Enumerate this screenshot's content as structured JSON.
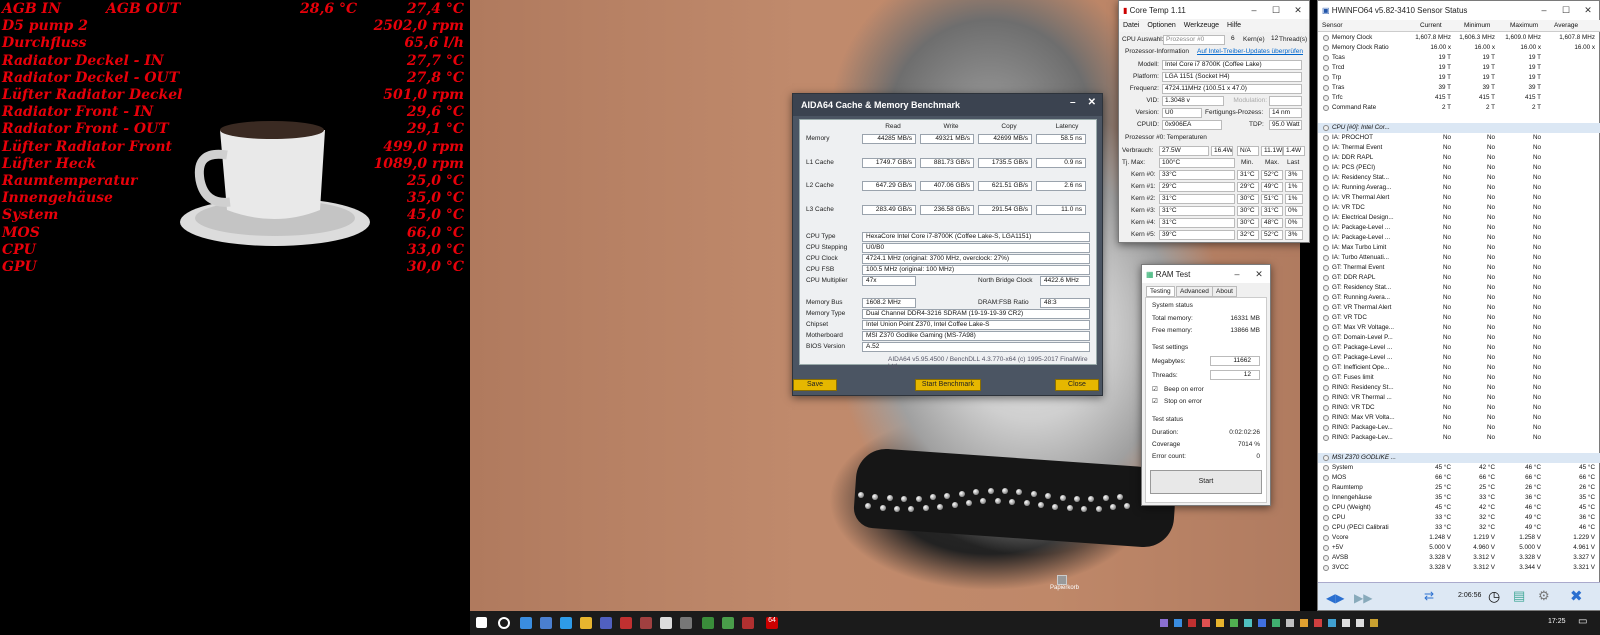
{
  "overlay": {
    "rows": [
      {
        "k": "AGB IN",
        "k2": "AGB OUT",
        "v2": "28,6 °C",
        "v": "27,4 °C"
      },
      {
        "k": "D5 pump 2",
        "v": "2502,0 rpm"
      },
      {
        "k": "Durchfluss",
        "v": "65,6 l/h"
      },
      {
        "k": "Radiator Deckel - IN",
        "v": "27,7 °C"
      },
      {
        "k": "Radiator Deckel - OUT",
        "v": "27,8 °C"
      },
      {
        "k": "Lüfter Radiator Deckel",
        "v": "501,0 rpm"
      },
      {
        "k": "Radiator Front - IN",
        "v": "29,6 °C"
      },
      {
        "k": "Radiator Front - OUT",
        "v": "29,1 °C"
      },
      {
        "k": "Lüfter Radiator Front",
        "v": "499,0 rpm"
      },
      {
        "k": "Lüfter Heck",
        "v": "1089,0 rpm"
      },
      {
        "k": "Raumtemperatur",
        "v": "25,0 °C"
      },
      {
        "k": "Innengehäuse",
        "v": "35,0 °C"
      },
      {
        "k": "System",
        "v": "45,0 °C"
      },
      {
        "k": "MOS",
        "v": "66,0 °C"
      },
      {
        "k": "CPU",
        "v": "33,0 °C"
      },
      {
        "k": "GPU",
        "v": "30,0 °C"
      }
    ]
  },
  "aida": {
    "title": "AIDA64 Cache & Memory Benchmark",
    "cols": [
      "Read",
      "Write",
      "Copy",
      "Latency"
    ],
    "rows": [
      {
        "label": "Memory",
        "v": [
          "44285 MB/s",
          "49321 MB/s",
          "42699 MB/s",
          "58.5 ns"
        ]
      },
      {
        "label": "L1 Cache",
        "v": [
          "1749.7 GB/s",
          "881.73 GB/s",
          "1735.5 GB/s",
          "0.9 ns"
        ]
      },
      {
        "label": "L2 Cache",
        "v": [
          "647.29 GB/s",
          "407.06 GB/s",
          "621.51 GB/s",
          "2.6 ns"
        ]
      },
      {
        "label": "L3 Cache",
        "v": [
          "283.49 GB/s",
          "236.58 GB/s",
          "291.54 GB/s",
          "11.0 ns"
        ]
      }
    ],
    "info": [
      {
        "label": "CPU Type",
        "v": "HexaCore Intel Core i7-8700K  (Coffee Lake-S, LGA1151)"
      },
      {
        "label": "CPU Stepping",
        "v": "U0/B0"
      },
      {
        "label": "CPU Clock",
        "v": "4724.1 MHz  (original: 3700 MHz, overclock: 27%)"
      },
      {
        "label": "CPU FSB",
        "v": "100.5 MHz  (original: 100 MHz)"
      },
      {
        "label": "CPU Multiplier",
        "v": "47x"
      }
    ],
    "nb_label": "North Bridge Clock",
    "nb_value": "4422.6 MHz",
    "info2": [
      {
        "label": "Memory Bus",
        "v": "1608.2 MHz"
      },
      {
        "label": "Memory Type",
        "v": "Dual Channel DDR4-3216 SDRAM  (19-19-19-39 CR2)"
      },
      {
        "label": "Chipset",
        "v": "Intel Union Point Z370, Intel Coffee Lake-S"
      },
      {
        "label": "Motherboard",
        "v": "MSI Z370 Godlike Gaming (MS-7A98)"
      },
      {
        "label": "BIOS Version",
        "v": "A.52"
      }
    ],
    "ratio_label": "DRAM:FSB Ratio",
    "ratio_value": "48:3",
    "footer": "AIDA64 v5.95.4500 / BenchDLL 4.3.770-x64  (c) 1995-2017 FinalWire Ltd.",
    "save": "Save",
    "start": "Start Benchmark",
    "close": "Close"
  },
  "coretemp": {
    "title": "Core Temp 1.11",
    "menu": [
      "Datei",
      "Optionen",
      "Werkzeuge",
      "Hilfe"
    ],
    "cpu_label": "CPU Auswahl:",
    "cpu_sel": "Prozessor #0",
    "cores": "6",
    "cores_label": "Kern(e)",
    "threads": "12",
    "threads_label": "Thread(s)",
    "proc_info": "Prozessor-Information",
    "link": "Auf Intel-Treiber-Updates überprüfen",
    "model_l": "Modell:",
    "model": "Intel Core i7 8700K (Coffee Lake)",
    "platform_l": "Platform:",
    "platform": "LGA 1151 (Socket H4)",
    "freq_l": "Frequenz:",
    "freq": "4724.11MHz (100.51 x 47.0)",
    "vid_l": "VID:",
    "vid": "1.3048 v",
    "mod_l": "Modulation:",
    "ver_l": "Version:",
    "ver": "U0",
    "fp_l": "Fertigungs-Prozess:",
    "fp": "14 nm",
    "cpuid_l": "CPUID:",
    "cpuid": "0x906EA",
    "tdp_l": "TDP:",
    "tdp": "95.0 Watt",
    "temps": "Prozessor #0: Temperaturen",
    "power_l": "Verbrauch:",
    "power": [
      "27.5W",
      "16.4W",
      "N/A",
      "11.1W",
      "1.4W"
    ],
    "tjmax_l": "Tj. Max:",
    "tjmax": "100°C",
    "min": "Min.",
    "max": "Max.",
    "last": "Last",
    "cores_t": [
      {
        "n": "Kern #0:",
        "t": "33°C",
        "mi": "31°C",
        "ma": "52°C",
        "l": "3%"
      },
      {
        "n": "Kern #1:",
        "t": "29°C",
        "mi": "29°C",
        "ma": "49°C",
        "l": "1%"
      },
      {
        "n": "Kern #2:",
        "t": "31°C",
        "mi": "30°C",
        "ma": "51°C",
        "l": "1%"
      },
      {
        "n": "Kern #3:",
        "t": "31°C",
        "mi": "30°C",
        "ma": "31°C",
        "l": "0%"
      },
      {
        "n": "Kern #4:",
        "t": "31°C",
        "mi": "30°C",
        "ma": "48°C",
        "l": "0%"
      },
      {
        "n": "Kern #5:",
        "t": "39°C",
        "mi": "32°C",
        "ma": "52°C",
        "l": "3%"
      }
    ]
  },
  "ramtest": {
    "title": "RAM Test",
    "tabs": [
      "Testing",
      "Advanced",
      "About"
    ],
    "sys_status": "System status",
    "total_l": "Total memory:",
    "total": "16331 MB",
    "free_l": "Free memory:",
    "free": "13866 MB",
    "settings": "Test settings",
    "mb_l": "Megabytes:",
    "mb": "11662",
    "th_l": "Threads:",
    "th": "12",
    "beep": "Beep on error",
    "stop": "Stop on error",
    "status": "Test status",
    "dur_l": "Duration:",
    "dur": "0:02:02:26",
    "cov_l": "Coverage",
    "cov": "7014 %",
    "err_l": "Error count:",
    "err": "0",
    "start": "Start"
  },
  "hwinfo": {
    "title": "HWiNFO64 v5.82-3410 Sensor Status",
    "cols": [
      "Sensor",
      "Current",
      "Minimum",
      "Maximum",
      "Average"
    ],
    "rows": [
      {
        "n": "Memory Clock",
        "c": "1,607.8 MHz",
        "mi": "1,606.3 MHz",
        "ma": "1,609.0 MHz",
        "a": "1,607.8 MHz"
      },
      {
        "n": "Memory Clock Ratio",
        "c": "16.00 x",
        "mi": "16.00 x",
        "ma": "16.00 x",
        "a": "16.00 x"
      },
      {
        "n": "Tcas",
        "c": "19 T",
        "mi": "19 T",
        "ma": "19 T",
        "a": ""
      },
      {
        "n": "Trcd",
        "c": "19 T",
        "mi": "19 T",
        "ma": "19 T",
        "a": ""
      },
      {
        "n": "Trp",
        "c": "19 T",
        "mi": "19 T",
        "ma": "19 T",
        "a": ""
      },
      {
        "n": "Tras",
        "c": "39 T",
        "mi": "39 T",
        "ma": "39 T",
        "a": ""
      },
      {
        "n": "Trfc",
        "c": "415 T",
        "mi": "415 T",
        "ma": "415 T",
        "a": ""
      },
      {
        "n": "Command Rate",
        "c": "2 T",
        "mi": "2 T",
        "ma": "2 T",
        "a": ""
      },
      {
        "n": "",
        "c": "",
        "mi": "",
        "ma": "",
        "a": ""
      },
      {
        "n": "CPU [#0]: Intel Cor...",
        "c": "",
        "mi": "",
        "ma": "",
        "a": "",
        "g": true
      },
      {
        "n": "IA: PROCHOT",
        "c": "No",
        "mi": "No",
        "ma": "No",
        "a": ""
      },
      {
        "n": "IA: Thermal Event",
        "c": "No",
        "mi": "No",
        "ma": "No",
        "a": ""
      },
      {
        "n": "IA: DDR RAPL",
        "c": "No",
        "mi": "No",
        "ma": "No",
        "a": ""
      },
      {
        "n": "IA: PCS (PECI)",
        "c": "No",
        "mi": "No",
        "ma": "No",
        "a": ""
      },
      {
        "n": "IA: Residency Stat...",
        "c": "No",
        "mi": "No",
        "ma": "No",
        "a": ""
      },
      {
        "n": "IA: Running Averag...",
        "c": "No",
        "mi": "No",
        "ma": "No",
        "a": ""
      },
      {
        "n": "IA: VR Thermal Alert",
        "c": "No",
        "mi": "No",
        "ma": "No",
        "a": ""
      },
      {
        "n": "IA: VR TDC",
        "c": "No",
        "mi": "No",
        "ma": "No",
        "a": ""
      },
      {
        "n": "IA: Electrical Design...",
        "c": "No",
        "mi": "No",
        "ma": "No",
        "a": ""
      },
      {
        "n": "IA: Package-Level ...",
        "c": "No",
        "mi": "No",
        "ma": "No",
        "a": ""
      },
      {
        "n": "IA: Package-Level ...",
        "c": "No",
        "mi": "No",
        "ma": "No",
        "a": ""
      },
      {
        "n": "IA: Max Turbo Limit",
        "c": "No",
        "mi": "No",
        "ma": "No",
        "a": ""
      },
      {
        "n": "IA: Turbo Attenuati...",
        "c": "No",
        "mi": "No",
        "ma": "No",
        "a": ""
      },
      {
        "n": "GT: Thermal Event",
        "c": "No",
        "mi": "No",
        "ma": "No",
        "a": ""
      },
      {
        "n": "GT: DDR RAPL",
        "c": "No",
        "mi": "No",
        "ma": "No",
        "a": ""
      },
      {
        "n": "GT: Residency Stat...",
        "c": "No",
        "mi": "No",
        "ma": "No",
        "a": ""
      },
      {
        "n": "GT: Running Avera...",
        "c": "No",
        "mi": "No",
        "ma": "No",
        "a": ""
      },
      {
        "n": "GT: VR Thermal Alert",
        "c": "No",
        "mi": "No",
        "ma": "No",
        "a": ""
      },
      {
        "n": "GT: VR TDC",
        "c": "No",
        "mi": "No",
        "ma": "No",
        "a": ""
      },
      {
        "n": "GT: Max VR Voltage...",
        "c": "No",
        "mi": "No",
        "ma": "No",
        "a": ""
      },
      {
        "n": "GT: Domain-Level P...",
        "c": "No",
        "mi": "No",
        "ma": "No",
        "a": ""
      },
      {
        "n": "GT: Package-Level ...",
        "c": "No",
        "mi": "No",
        "ma": "No",
        "a": ""
      },
      {
        "n": "GT: Package-Level ...",
        "c": "No",
        "mi": "No",
        "ma": "No",
        "a": ""
      },
      {
        "n": "GT: Inefficient Ope...",
        "c": "No",
        "mi": "No",
        "ma": "No",
        "a": ""
      },
      {
        "n": "GT: Fuses limit",
        "c": "No",
        "mi": "No",
        "ma": "No",
        "a": ""
      },
      {
        "n": "RING: Residency St...",
        "c": "No",
        "mi": "No",
        "ma": "No",
        "a": ""
      },
      {
        "n": "RING: VR Thermal ...",
        "c": "No",
        "mi": "No",
        "ma": "No",
        "a": ""
      },
      {
        "n": "RING: VR TDC",
        "c": "No",
        "mi": "No",
        "ma": "No",
        "a": ""
      },
      {
        "n": "RING: Max VR Volta...",
        "c": "No",
        "mi": "No",
        "ma": "No",
        "a": ""
      },
      {
        "n": "RING: Package-Lev...",
        "c": "No",
        "mi": "No",
        "ma": "No",
        "a": ""
      },
      {
        "n": "RING: Package-Lev...",
        "c": "No",
        "mi": "No",
        "ma": "No",
        "a": ""
      },
      {
        "n": "",
        "c": "",
        "mi": "",
        "ma": "",
        "a": ""
      },
      {
        "n": "MSI Z370 GODLIKE ...",
        "c": "",
        "mi": "",
        "ma": "",
        "a": "",
        "g": true
      },
      {
        "n": "System",
        "c": "45 °C",
        "mi": "42 °C",
        "ma": "46 °C",
        "a": "45 °C"
      },
      {
        "n": "MOS",
        "c": "66 °C",
        "mi": "66 °C",
        "ma": "66 °C",
        "a": "66 °C"
      },
      {
        "n": "Raumtemp",
        "c": "25 °C",
        "mi": "25 °C",
        "ma": "26 °C",
        "a": "26 °C"
      },
      {
        "n": "Innengehäuse",
        "c": "35 °C",
        "mi": "33 °C",
        "ma": "36 °C",
        "a": "35 °C"
      },
      {
        "n": "CPU (Weight)",
        "c": "45 °C",
        "mi": "42 °C",
        "ma": "46 °C",
        "a": "45 °C"
      },
      {
        "n": "CPU",
        "c": "33 °C",
        "mi": "32 °C",
        "ma": "49 °C",
        "a": "36 °C"
      },
      {
        "n": "CPU (PECI Calibrati",
        "c": "33 °C",
        "mi": "32 °C",
        "ma": "49 °C",
        "a": "46 °C"
      },
      {
        "n": "Vcore",
        "c": "1.248 V",
        "mi": "1.219 V",
        "ma": "1.258 V",
        "a": "1.229 V"
      },
      {
        "n": "+5V",
        "c": "5.000 V",
        "mi": "4.960 V",
        "ma": "5.000 V",
        "a": "4.961 V"
      },
      {
        "n": "AVSB",
        "c": "3.328 V",
        "mi": "3.312 V",
        "ma": "3.328 V",
        "a": "3.327 V"
      },
      {
        "n": "3VCC",
        "c": "3.328 V",
        "mi": "3.312 V",
        "ma": "3.344 V",
        "a": "3.321 V"
      }
    ],
    "time": "2:06:56"
  },
  "desktop": {
    "icon_label": "Papierkorb"
  },
  "taskbar": {
    "time": "17:25"
  }
}
